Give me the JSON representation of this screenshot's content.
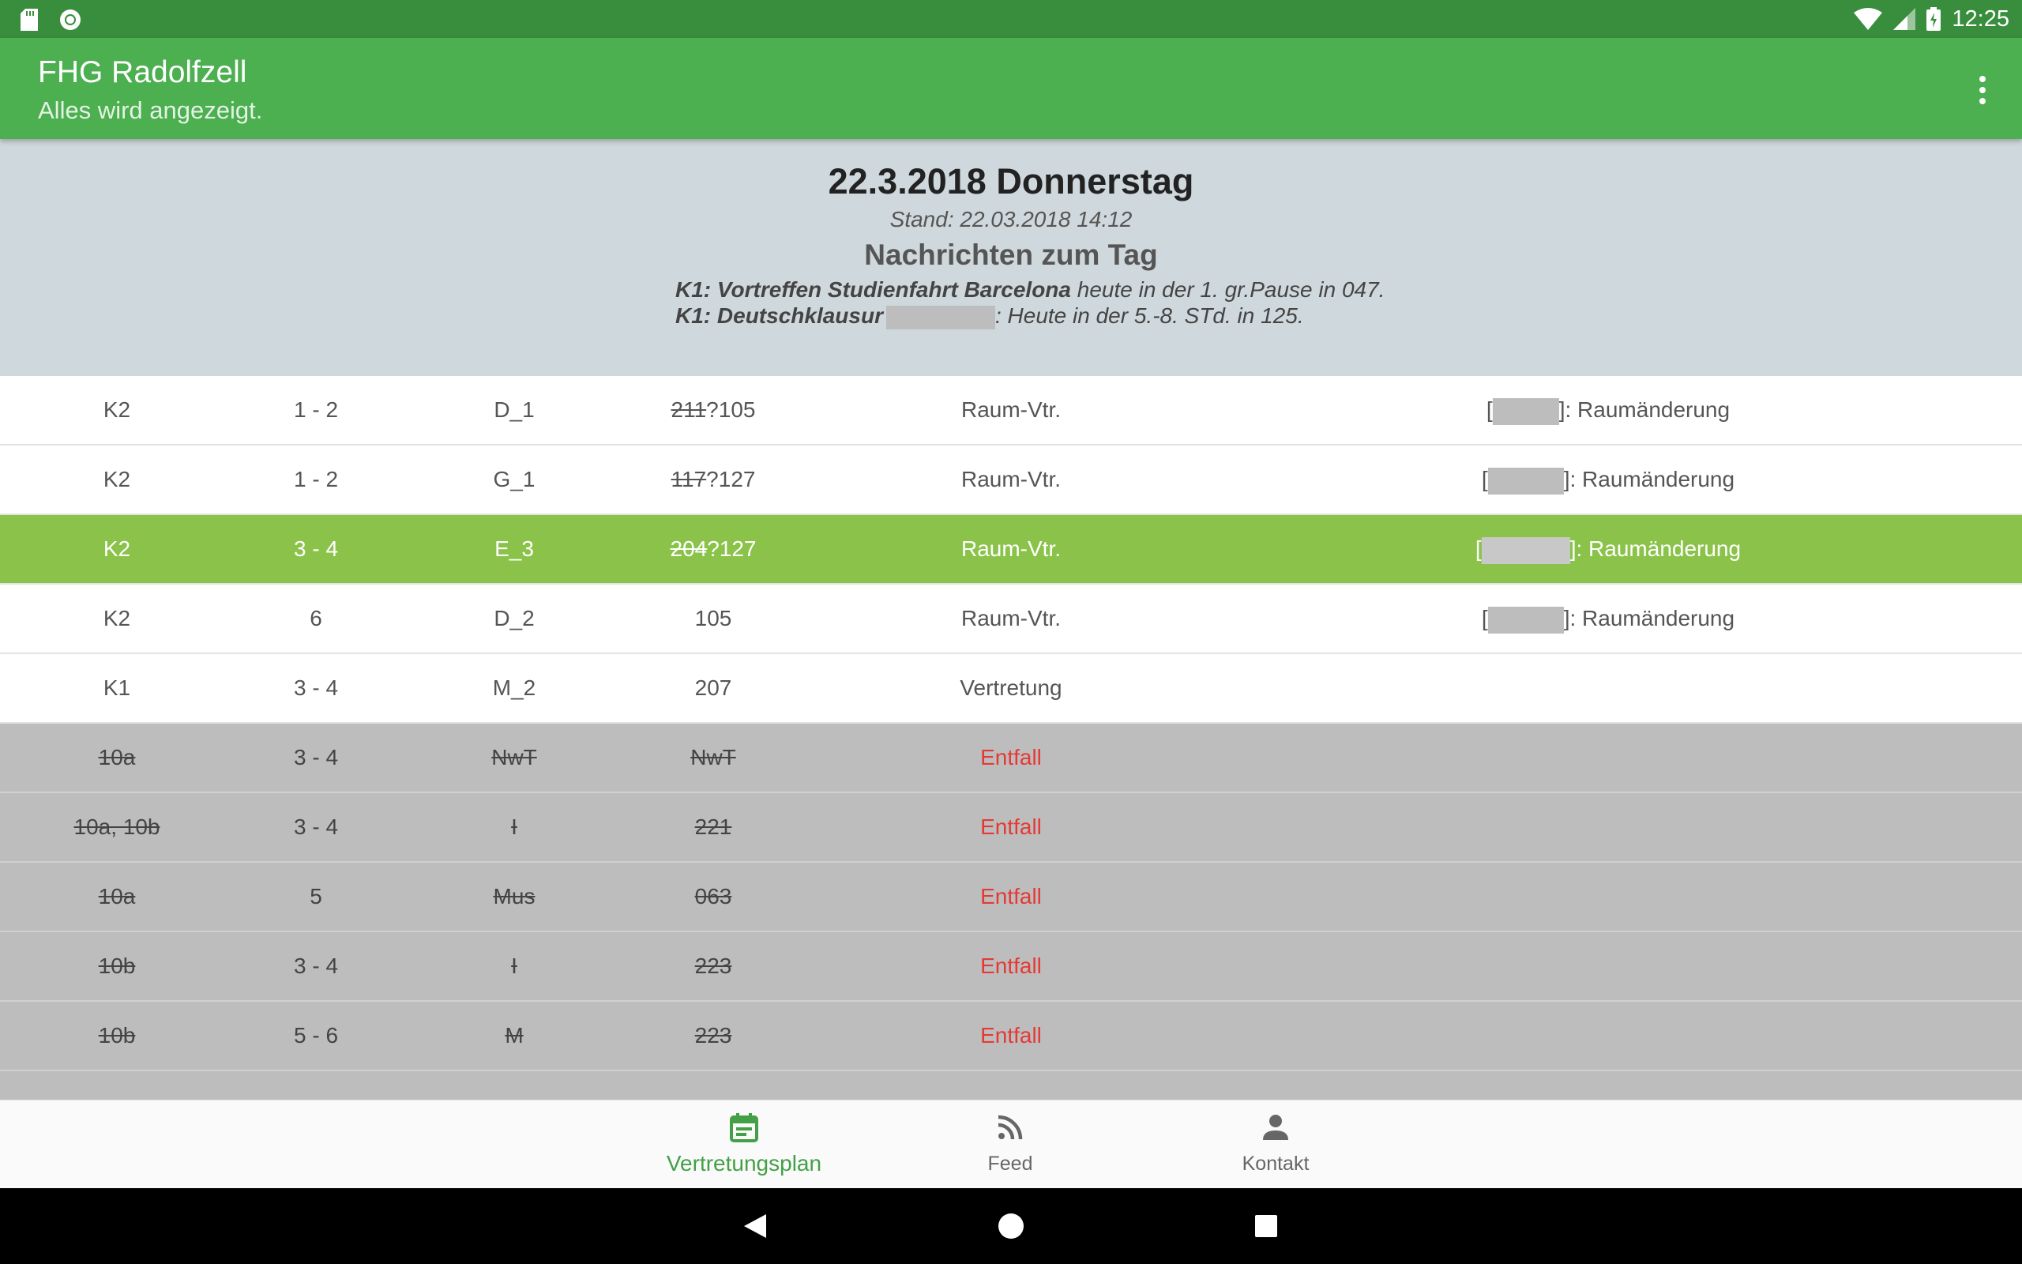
{
  "status_bar": {
    "time": "12:25"
  },
  "app_bar": {
    "title": "FHG Radolfzell",
    "subtitle": "Alles wird angezeigt."
  },
  "day": {
    "title": "22.3.2018 Donnerstag",
    "stand": "Stand: 22.03.2018 14:12",
    "messages_heading": "Nachrichten zum Tag",
    "messages": [
      {
        "bold": "K1: Vortreffen Studienfahrt Barcelona",
        "text": " heute in der 1. gr.Pause in 047."
      },
      {
        "bold": "K1: Deutschklausur",
        "text": ": Heute in der 5.-8. STd. in 125."
      }
    ]
  },
  "rows": [
    {
      "class": "K2",
      "hours": "1 - 2",
      "subject": "D_1",
      "room_old": "211",
      "room": "?105",
      "type": "Raum-Vtr.",
      "note": ": Raumänderung"
    },
    {
      "class": "K2",
      "hours": "1 - 2",
      "subject": "G_1",
      "room_old": "117",
      "room": "?127",
      "type": "Raum-Vtr.",
      "note": ": Raumänderung"
    },
    {
      "class": "K2",
      "hours": "3 - 4",
      "subject": "E_3",
      "room_old": "204",
      "room": "?127",
      "type": "Raum-Vtr.",
      "note": ": Raumänderung"
    },
    {
      "class": "K2",
      "hours": "6",
      "subject": "D_2",
      "room_old": "",
      "room": "105",
      "type": "Raum-Vtr.",
      "note": ": Raumänderung"
    },
    {
      "class": "K1",
      "hours": "3 - 4",
      "subject": "M_2",
      "room_old": "",
      "room": "207",
      "type": "Vertretung",
      "note": ""
    },
    {
      "class": "10a",
      "hours": "3 - 4",
      "subject": "NwT",
      "room_old": "",
      "room": "NwT",
      "type": "Entfall",
      "note": ""
    },
    {
      "class": "10a, 10b",
      "hours": "3 - 4",
      "subject": "I",
      "room_old": "",
      "room": "221",
      "type": "Entfall",
      "note": ""
    },
    {
      "class": "10a",
      "hours": "5",
      "subject": "Mus",
      "room_old": "",
      "room": "063",
      "type": "Entfall",
      "note": ""
    },
    {
      "class": "10b",
      "hours": "3 - 4",
      "subject": "I",
      "room_old": "",
      "room": "223",
      "type": "Entfall",
      "note": ""
    },
    {
      "class": "10b",
      "hours": "5 - 6",
      "subject": "M",
      "room_old": "",
      "room": "223",
      "type": "Entfall",
      "note": ""
    }
  ],
  "bottom_nav": [
    {
      "label": "Vertretungsplan",
      "icon": "calendar-icon",
      "active": true
    },
    {
      "label": "Feed",
      "icon": "rss-feed-icon",
      "active": false
    },
    {
      "label": "Kontakt",
      "icon": "person-icon",
      "active": false
    }
  ],
  "colors": {
    "status_bar": "#388E3C",
    "app_bar": "#4CAF50",
    "highlight_row": "#8BC34A",
    "cancel_row": "#BDBDBD",
    "cancel_text": "#E53935",
    "header_bg": "#CFD8DC"
  }
}
